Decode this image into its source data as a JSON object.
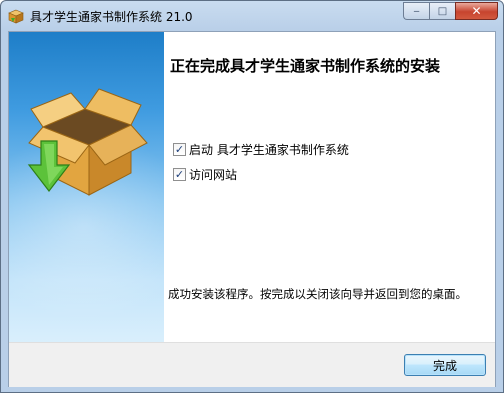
{
  "window": {
    "title": "具才学生通家书制作系统 21.0",
    "controls": {
      "minimize": "‒",
      "maximize": "□",
      "close": "✕"
    }
  },
  "sidebar": {
    "art_icon": "box-install-icon"
  },
  "main": {
    "heading": "正在完成具才学生通家书制作系统的安装",
    "options": [
      {
        "label": "启动 具才学生通家书制作系统",
        "checked": true
      },
      {
        "label": "访问网站",
        "checked": true
      }
    ],
    "message": "成功安装该程序。按完成以关闭该向导并返回到您的桌面。"
  },
  "footer": {
    "finish_label": "完成"
  },
  "colors": {
    "sidebar_top": "#1e7ec8",
    "sidebar_bottom": "#d9effc",
    "button_border": "#3c7fb1"
  }
}
